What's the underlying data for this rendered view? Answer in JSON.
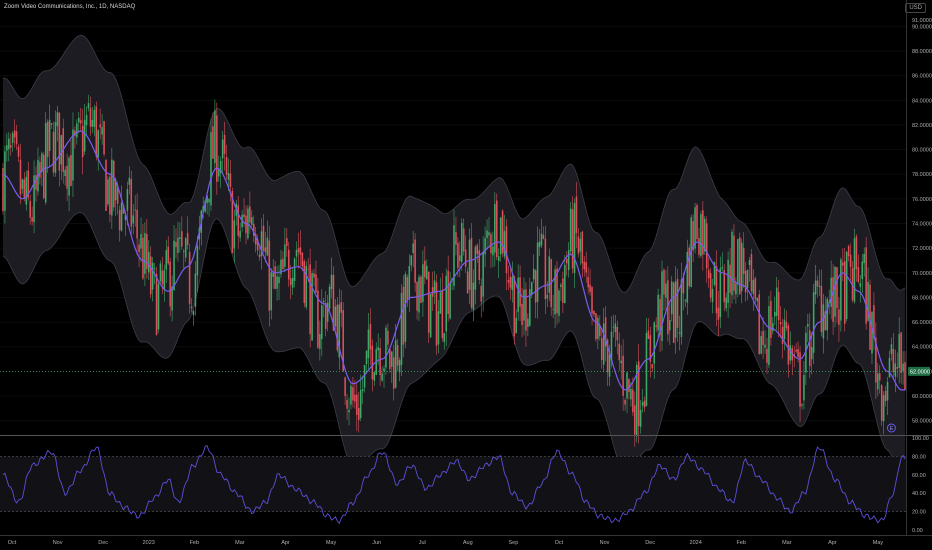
{
  "header": {
    "title": "Zoom Video Communications, Inc., 1D, NASDAQ",
    "currency": "USD"
  },
  "colors": {
    "up": "#3fa968",
    "down": "#e0505a",
    "basis": "#7b5cf0",
    "band_fill": "#1c1c22",
    "band_line": "#3d3d48",
    "rsi": "#5a50d8",
    "price_line": "#3fa968",
    "axis_text": "#b0b0b0"
  },
  "event_marker": {
    "label": "E"
  },
  "chart_data": [
    {
      "type": "candlestick",
      "title": "Zoom Video Communications, Inc., 1D, NASDAQ",
      "ylim": [
        57,
        91
      ],
      "yticks": [
        58,
        60,
        62,
        64,
        66,
        68,
        70,
        72,
        74,
        76,
        78,
        80,
        82,
        84,
        86,
        88,
        90
      ],
      "ytick_labels": [
        "58.0000",
        "60.0000",
        "62.0000",
        "64.0000",
        "66.0000",
        "68.0000",
        "70.0000",
        "72.0000",
        "74.0000",
        "76.0000",
        "78.0000",
        "80.0000",
        "82.0000",
        "84.0000",
        "86.0000",
        "88.0000",
        "90.0000"
      ],
      "top_label": "91.0000",
      "last_price": 62.0,
      "last_price_label": "62.0000",
      "xtick_labels": [
        "Oct",
        "Nov",
        "Dec",
        "2023",
        "Feb",
        "Mar",
        "Apr",
        "May",
        "Jun",
        "Jul",
        "Aug",
        "Sep",
        "Oct",
        "Nov",
        "Dec",
        "2024",
        "Feb",
        "Mar",
        "Apr",
        "May"
      ],
      "basis_anchors": [
        [
          0,
          78
        ],
        [
          10,
          76
        ],
        [
          22,
          78.5
        ],
        [
          40,
          81.5
        ],
        [
          55,
          78
        ],
        [
          72,
          71
        ],
        [
          85,
          68.5
        ],
        [
          95,
          70.5
        ],
        [
          110,
          78.5
        ],
        [
          125,
          74
        ],
        [
          140,
          70
        ],
        [
          152,
          70.5
        ],
        [
          165,
          67.5
        ],
        [
          180,
          61
        ],
        [
          195,
          63
        ],
        [
          210,
          68
        ],
        [
          225,
          68.5
        ],
        [
          240,
          71
        ],
        [
          255,
          72.5
        ],
        [
          268,
          68
        ],
        [
          280,
          69
        ],
        [
          292,
          71.5
        ],
        [
          305,
          66
        ],
        [
          320,
          60.5
        ],
        [
          332,
          63
        ],
        [
          345,
          68
        ],
        [
          357,
          72.5
        ],
        [
          370,
          70
        ],
        [
          380,
          69
        ],
        [
          395,
          65.5
        ],
        [
          410,
          63
        ],
        [
          420,
          66
        ],
        [
          432,
          70
        ],
        [
          440,
          68.5
        ],
        [
          455,
          62
        ],
        [
          462,
          60.5
        ]
      ],
      "band_halfwidth": [
        7,
        5
      ]
    },
    {
      "type": "line",
      "ylim": [
        0,
        100
      ],
      "yticks": [
        0,
        20,
        40,
        60,
        80,
        100
      ],
      "ytick_labels": [
        "0.00",
        "20.00",
        "40.00",
        "60.00",
        "80.00",
        "100.00"
      ],
      "levels": [
        20,
        80
      ],
      "rsi_anchors": [
        [
          0,
          60
        ],
        [
          8,
          30
        ],
        [
          15,
          70
        ],
        [
          25,
          85
        ],
        [
          32,
          40
        ],
        [
          40,
          65
        ],
        [
          48,
          90
        ],
        [
          55,
          40
        ],
        [
          62,
          25
        ],
        [
          70,
          15
        ],
        [
          78,
          35
        ],
        [
          85,
          55
        ],
        [
          90,
          30
        ],
        [
          98,
          70
        ],
        [
          105,
          90
        ],
        [
          112,
          60
        ],
        [
          120,
          40
        ],
        [
          128,
          20
        ],
        [
          135,
          30
        ],
        [
          142,
          60
        ],
        [
          150,
          45
        ],
        [
          160,
          30
        ],
        [
          167,
          15
        ],
        [
          173,
          10
        ],
        [
          180,
          30
        ],
        [
          188,
          60
        ],
        [
          195,
          85
        ],
        [
          203,
          50
        ],
        [
          210,
          70
        ],
        [
          218,
          45
        ],
        [
          225,
          60
        ],
        [
          233,
          75
        ],
        [
          240,
          55
        ],
        [
          248,
          70
        ],
        [
          255,
          80
        ],
        [
          262,
          40
        ],
        [
          270,
          25
        ],
        [
          277,
          50
        ],
        [
          285,
          85
        ],
        [
          293,
          60
        ],
        [
          300,
          30
        ],
        [
          307,
          15
        ],
        [
          315,
          10
        ],
        [
          322,
          20
        ],
        [
          330,
          40
        ],
        [
          338,
          70
        ],
        [
          345,
          55
        ],
        [
          352,
          80
        ],
        [
          360,
          65
        ],
        [
          368,
          45
        ],
        [
          375,
          30
        ],
        [
          382,
          75
        ],
        [
          390,
          55
        ],
        [
          398,
          35
        ],
        [
          405,
          20
        ],
        [
          412,
          40
        ],
        [
          420,
          90
        ],
        [
          428,
          55
        ],
        [
          436,
          30
        ],
        [
          444,
          15
        ],
        [
          452,
          10
        ],
        [
          458,
          40
        ],
        [
          462,
          78
        ]
      ]
    }
  ]
}
